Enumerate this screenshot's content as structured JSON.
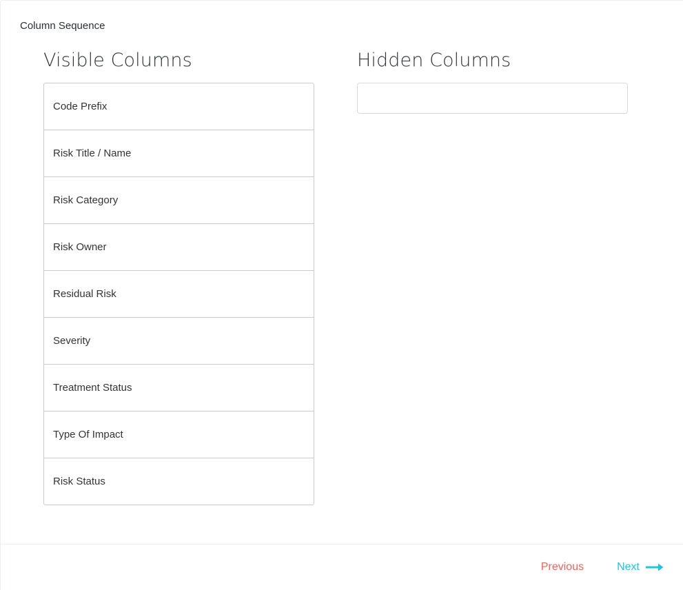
{
  "step": {
    "title": "Column Sequence"
  },
  "panes": {
    "visible": {
      "heading": "Visible Columns",
      "items": [
        {
          "label": "Code Prefix"
        },
        {
          "label": "Risk Title / Name"
        },
        {
          "label": "Risk Category"
        },
        {
          "label": "Risk Owner"
        },
        {
          "label": "Residual Risk"
        },
        {
          "label": "Severity"
        },
        {
          "label": "Treatment Status"
        },
        {
          "label": "Type Of Impact"
        },
        {
          "label": "Risk Status"
        }
      ]
    },
    "hidden": {
      "heading": "Hidden Columns",
      "items": []
    }
  },
  "footer": {
    "previous_label": "Previous",
    "next_label": "Next",
    "next_icon": "arrow-right-icon"
  },
  "colors": {
    "previous": "#f4605a",
    "next": "#1ec7dd",
    "item_border": "#c9cbcd",
    "panel_border": "#eceef0",
    "text": "#333333"
  }
}
